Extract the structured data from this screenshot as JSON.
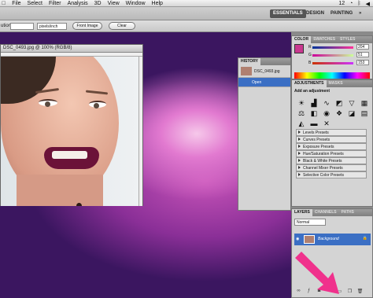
{
  "menubar": {
    "items": [
      "File",
      "Select",
      "Filter",
      "Analysis",
      "3D",
      "View",
      "Window",
      "Help"
    ],
    "status_number": "12"
  },
  "workspace": {
    "essentials": "ESSENTIALS",
    "design": "DESIGN",
    "painting": "PAINTING"
  },
  "options": {
    "resolution_label": "ution:",
    "units": "pixels/inch",
    "front_image": "Front Image",
    "clear": "Clear"
  },
  "document": {
    "title": "DSC_0493.jpg @ 100% (RGB/8)"
  },
  "history": {
    "tab": "HISTORY",
    "snapshot": "DSC_0493.jpg",
    "open": "Open"
  },
  "color_panel": {
    "tabs": [
      "COLOR",
      "SWATCHES",
      "STYLES"
    ],
    "channels": [
      {
        "label": "R",
        "value": "204"
      },
      {
        "label": "G",
        "value": "51"
      },
      {
        "label": "B",
        "value": "153"
      }
    ],
    "foreground": "#cc3399"
  },
  "adjustments": {
    "tabs": [
      "ADJUSTMENTS",
      "MASKS"
    ],
    "heading": "Add an adjustment",
    "icons": [
      "brightness-icon",
      "levels-icon",
      "curves-icon",
      "exposure-icon",
      "vibrance-icon",
      "hue-icon",
      "color-balance-icon",
      "bw-icon",
      "photo-filter-icon",
      "channel-mixer-icon",
      "invert-icon",
      "posterize-icon",
      "threshold-icon",
      "gradient-map-icon",
      "selective-color-icon"
    ],
    "presets": [
      "Levels Presets",
      "Curves Presets",
      "Exposure Presets",
      "Hue/Saturation Presets",
      "Black & White Presets",
      "Channel Mixer Presets",
      "Selective Color Presets"
    ]
  },
  "layers": {
    "tabs": [
      "LAYERS",
      "CHANNELS",
      "PATHS"
    ],
    "mode": "Normal",
    "layer_name": "Background"
  }
}
